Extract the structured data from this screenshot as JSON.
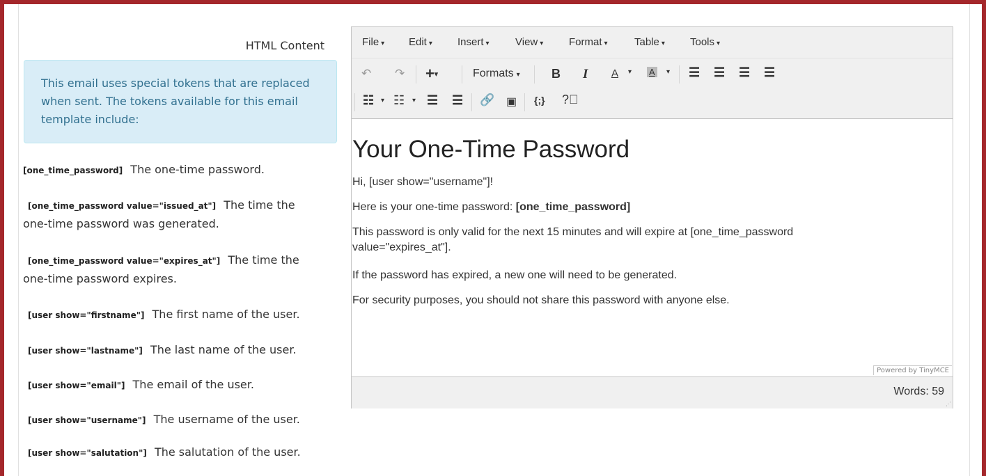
{
  "field": {
    "label": "HTML Content"
  },
  "info_box": {
    "text": "This email uses special tokens that are replaced when sent. The tokens available for this email template include:"
  },
  "tokens": [
    {
      "token": "[one_time_password]",
      "desc": "The one-time password."
    },
    {
      "token": "[one_time_password value=\"issued_at\"]",
      "desc": "The time the one-time password was generated."
    },
    {
      "token": "[one_time_password value=\"expires_at\"]",
      "desc": "The time the one-time password expires."
    },
    {
      "token": "[user show=\"firstname\"]",
      "desc": "The first name of the user."
    },
    {
      "token": "[user show=\"lastname\"]",
      "desc": "The last name of the user."
    },
    {
      "token": "[user show=\"email\"]",
      "desc": "The email of the user."
    },
    {
      "token": "[user show=\"username\"]",
      "desc": "The username of the user."
    },
    {
      "token": "[user show=\"salutation\"]",
      "desc": "The salutation of the user."
    }
  ],
  "editor": {
    "menu": [
      "File",
      "Edit",
      "Insert",
      "View",
      "Format",
      "Table",
      "Tools"
    ],
    "toolbar": {
      "formats_label": "Formats",
      "bold": "B",
      "italic": "I",
      "text_color": "A",
      "bg_color": "A",
      "code": "{;}"
    },
    "content": {
      "heading": "Your One-Time Password",
      "line1": "Hi, [user show=\"username\"]!",
      "line2_prefix": "Here is your one-time password: ",
      "line2_token": "[one_time_password]",
      "line3a": "This password is only valid for the next 15 minutes and will expire at [one_time_password",
      "line3b": "value=\"expires_at\"].",
      "line4": "If the password has expired, a new one will need to be generated.",
      "line5": "For security purposes, you should not share this password with anyone else."
    },
    "powered_by": "Powered by TinyMCE",
    "word_count": "Words: 59"
  }
}
